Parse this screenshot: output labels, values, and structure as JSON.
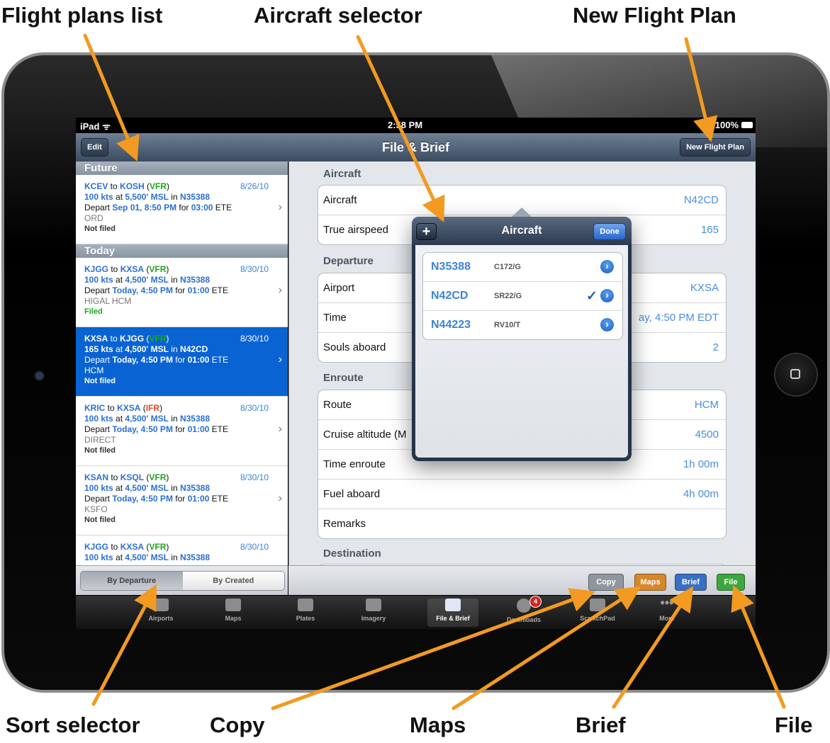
{
  "callouts": {
    "flight_plans_list": "Flight plans list",
    "aircraft_selector": "Aircraft selector",
    "new_flight_plan": "New Flight Plan",
    "sort_selector": "Sort selector",
    "copy": "Copy",
    "maps": "Maps",
    "brief": "Brief",
    "file": "File"
  },
  "status_bar": {
    "device": "iPad",
    "time": "2:58 PM",
    "battery": "100%"
  },
  "navbar": {
    "title": "File & Brief",
    "edit_label": "Edit",
    "new_plan_label": "New Flight Plan"
  },
  "flight_plans": {
    "sections": [
      {
        "header": "Future",
        "items": [
          {
            "from": "KCEV",
            "to": "KOSH",
            "rules": "VFR",
            "date": "8/26/10",
            "speed": "100 kts",
            "altitude": "5,500' MSL",
            "aircraft": "N35388",
            "depart": "Sep 01, 8:50 PM",
            "ete": "03:00",
            "route": "ORD",
            "status": "Not filed"
          }
        ]
      },
      {
        "header": "Today",
        "items": [
          {
            "from": "KJGG",
            "to": "KXSA",
            "rules": "VFR",
            "date": "8/30/10",
            "speed": "100 kts",
            "altitude": "4,500' MSL",
            "aircraft": "N35388",
            "depart": "Today, 4:50 PM",
            "ete": "01:00",
            "route": "HIGAL HCM",
            "status": "Filed"
          },
          {
            "from": "KXSA",
            "to": "KJGG",
            "rules": "VFR",
            "date": "8/30/10",
            "speed": "165 kts",
            "altitude": "4,500' MSL",
            "aircraft": "N42CD",
            "depart": "Today, 4:50 PM",
            "ete": "01:00",
            "route": "HCM",
            "status": "Not filed"
          },
          {
            "from": "KRIC",
            "to": "KXSA",
            "rules": "IFR",
            "date": "8/30/10",
            "speed": "100 kts",
            "altitude": "4,500' MSL",
            "aircraft": "N35388",
            "depart": "Today, 4:50 PM",
            "ete": "01:00",
            "route": "DIRECT",
            "status": "Not filed"
          },
          {
            "from": "KSAN",
            "to": "KSQL",
            "rules": "VFR",
            "date": "8/30/10",
            "speed": "100 kts",
            "altitude": "4,500' MSL",
            "aircraft": "N35388",
            "depart": "Today, 4:50 PM",
            "ete": "01:00",
            "route": "KSFO",
            "status": "Not filed"
          },
          {
            "from": "KJGG",
            "to": "KXSA",
            "rules": "VFR",
            "date": "8/30/10",
            "speed": "100 kts",
            "altitude": "4,500' MSL",
            "aircraft": "N35388",
            "depart": "",
            "ete": "",
            "route": "",
            "status": ""
          }
        ]
      }
    ],
    "words": {
      "to": "to",
      "at": "at",
      "in": "in",
      "depart": "Depart",
      "for": "for",
      "ete": "ETE"
    }
  },
  "sort": {
    "by_departure": "By Departure",
    "by_created": "By Created",
    "selected": "By Departure"
  },
  "form": {
    "aircraft_group": {
      "label": "Aircraft",
      "rows": [
        {
          "key": "Aircraft",
          "value": "N42CD"
        },
        {
          "key": "True airspeed",
          "value": "165"
        }
      ]
    },
    "departure_group": {
      "label": "Departure",
      "rows": [
        {
          "key": "Airport",
          "value": "KXSA"
        },
        {
          "key": "Time",
          "value": "ay, 4:50 PM EDT"
        },
        {
          "key": "Souls aboard",
          "value": "2"
        }
      ]
    },
    "enroute_group": {
      "label": "Enroute",
      "rows": [
        {
          "key": "Route",
          "value": "HCM"
        },
        {
          "key": "Cruise altitude (M",
          "value": "4500"
        },
        {
          "key": "Time enroute",
          "value": "1h 00m"
        },
        {
          "key": "Fuel aboard",
          "value": "4h 00m"
        },
        {
          "key": "Remarks",
          "value": ""
        }
      ]
    },
    "destination_group": {
      "label": "Destination"
    }
  },
  "actions": {
    "copy": "Copy",
    "maps": "Maps",
    "brief": "Brief",
    "file": "File"
  },
  "action_colors": {
    "copy": "#8f969f",
    "maps": "#d6862b",
    "brief": "#3b6fc4",
    "file": "#3ea63e"
  },
  "tabs": [
    {
      "label": "Airports",
      "icon": "airports-icon"
    },
    {
      "label": "Maps",
      "icon": "maps-icon"
    },
    {
      "label": "Plates",
      "icon": "plates-icon"
    },
    {
      "label": "Imagery",
      "icon": "imagery-icon"
    },
    {
      "label": "File & Brief",
      "icon": "file-brief-icon",
      "active": true
    },
    {
      "label": "Downloads",
      "icon": "downloads-icon",
      "badge": "4"
    },
    {
      "label": "ScratchPad",
      "icon": "scratchpad-icon"
    },
    {
      "label": "More",
      "icon": "more-icon"
    }
  ],
  "aircraft_popover": {
    "title": "Aircraft",
    "add_label": "+",
    "done_label": "Done",
    "items": [
      {
        "id": "N35388",
        "type": "C172/G",
        "selected": false
      },
      {
        "id": "N42CD",
        "type": "SR22/G",
        "selected": true
      },
      {
        "id": "N44223",
        "type": "RV10/T",
        "selected": false
      }
    ],
    "check_glyph": "✓"
  },
  "accent_color": "#f29a21"
}
